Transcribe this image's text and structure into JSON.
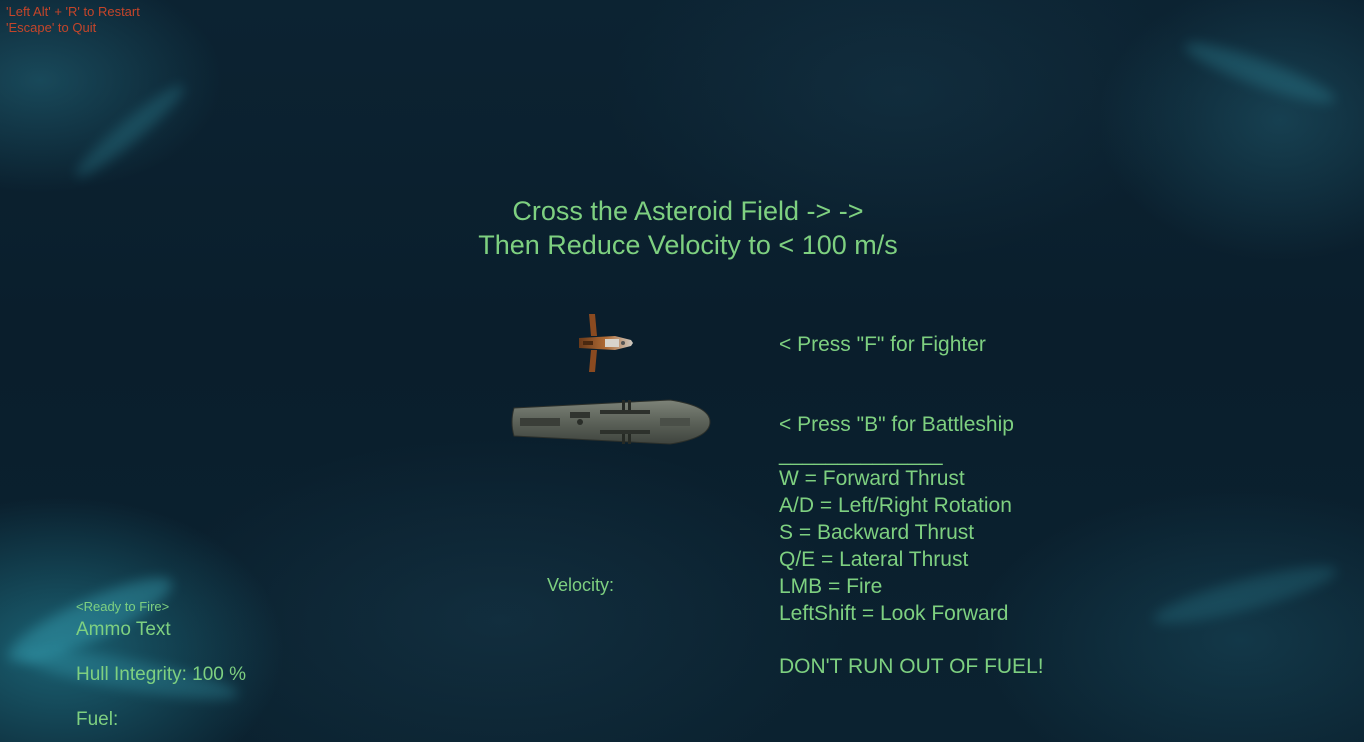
{
  "system": {
    "restart_hint": "'Left Alt' + 'R' to Restart",
    "quit_hint": "'Escape' to Quit"
  },
  "objective": {
    "line1": "Cross the Asteroid Field -> ->",
    "line2": "Then Reduce Velocity to < 100 m/s"
  },
  "ship_select": {
    "fighter_label": "< Press \"F\" for Fighter",
    "battleship_label": "< Press \"B\" for Battleship"
  },
  "controls": {
    "separator": "______________",
    "items": [
      "W = Forward Thrust",
      "A/D = Left/Right Rotation",
      "S = Backward Thrust",
      "Q/E = Lateral Thrust",
      "LMB = Fire",
      "LeftShift = Look Forward"
    ],
    "warning": "DON'T RUN OUT OF FUEL!"
  },
  "hud": {
    "weapon_status": "<Ready to Fire>",
    "ammo": "Ammo Text",
    "hull": "Hull Integrity: 100 %",
    "fuel": "Fuel:",
    "velocity": "Velocity:"
  },
  "colors": {
    "text_green": "#7ed080",
    "system_red": "#c4452a",
    "space_bg": "#0a1e2c",
    "nebula_cyan": "#3fb5c8"
  },
  "icons": {
    "fighter": "fighter-ship-icon",
    "battleship": "battleship-icon"
  }
}
